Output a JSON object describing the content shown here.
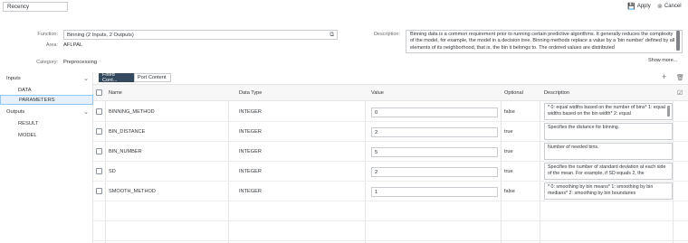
{
  "toolbar": {
    "title_value": "Recency",
    "apply_label": "Apply",
    "cancel_label": "Cancel",
    "apply_icon": "save-icon",
    "cancel_icon": "close-circle-icon"
  },
  "form": {
    "function_label": "Function:",
    "function_value": "Binning (2 Inputs, 2 Outputs)",
    "area_label": "Area:",
    "area_value": "AFLPAL",
    "category_label": "Category:",
    "category_value": "Preprocessing",
    "description_label": "Description:",
    "description_value": "Binning data is a common requirement prior to running certain predictive algorithms. It generally reduces the complexity of the model, for example, the model in a decision tree. Binning methods replace a value by a 'bin number' defined by all elements of its neighborhood, that is, the bin it belongs to. The ordered values are distributed",
    "show_more_label": "Show more..."
  },
  "sidebar": {
    "inputs_label": "Inputs",
    "inputs_items": [
      "DATA",
      "PARAMETERS"
    ],
    "outputs_label": "Outputs",
    "outputs_items": [
      "RESULT",
      "MODEL"
    ],
    "selected": "PARAMETERS"
  },
  "tabs": {
    "fixed_label": "Fixed Cont...",
    "port_label": "Port Content"
  },
  "table": {
    "headers": {
      "name": "Name",
      "data_type": "Data Type",
      "value": "Value",
      "optional": "Optional",
      "description": "Description"
    },
    "rows": [
      {
        "name": "BINNING_METHOD",
        "data_type": "INTEGER",
        "value": "0",
        "optional": "false",
        "description": "* 0: equal widths based on the number of bins* 1: equal widths based on the bin width* 2: equal"
      },
      {
        "name": "BIN_DISTANCE",
        "data_type": "INTEGER",
        "value": "2",
        "optional": "true",
        "description": "Specifies the distance for binning."
      },
      {
        "name": "BIN_NUMBER",
        "data_type": "INTEGER",
        "value": "5",
        "optional": "true",
        "description": "Number of needed bins."
      },
      {
        "name": "SD",
        "data_type": "INTEGER",
        "value": "2",
        "optional": "true",
        "description": "Specifies the number of standard deviation at each side of the mean. For example, if SD equals 2, the"
      },
      {
        "name": "SMOOTH_METHOD",
        "data_type": "INTEGER",
        "value": "1",
        "optional": "false",
        "description": "* 0: smoothing by bin means* 1: smoothing by bin medians* 2: smoothing by bin boundaries"
      }
    ]
  }
}
